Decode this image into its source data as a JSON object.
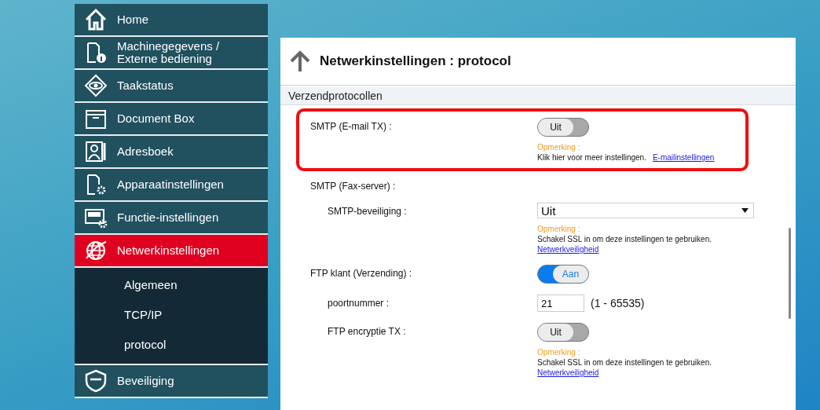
{
  "sidebar": {
    "items": [
      {
        "label": "Home",
        "selected": false
      },
      {
        "label": "Machinegegevens /\nExterne bediening",
        "selected": false
      },
      {
        "label": "Taakstatus",
        "selected": false
      },
      {
        "label": "Document Box",
        "selected": false
      },
      {
        "label": "Adresboek",
        "selected": false
      },
      {
        "label": "Apparaatinstellingen",
        "selected": false
      },
      {
        "label": "Functie-instellingen",
        "selected": false
      },
      {
        "label": "Netwerkinstellingen",
        "selected": true,
        "children": [
          {
            "label": "Algemeen"
          },
          {
            "label": "TCP/IP"
          },
          {
            "label": "protocol"
          }
        ]
      },
      {
        "label": "Beveiliging",
        "selected": false
      }
    ]
  },
  "page": {
    "title": "Netwerkinstellingen : protocol",
    "section": "Verzendprotocollen",
    "settings": [
      {
        "kind": "toggle",
        "label": "SMTP (E-mail TX) :",
        "nested": false,
        "highlighted": true,
        "on": false,
        "value": "Uit",
        "note": {
          "title": "Opmerking :",
          "text": "Klik hier voor meer instellingen.",
          "link": "E-mailinstellingen",
          "inline": true
        }
      },
      {
        "kind": "heading",
        "label": "SMTP (Fax-server) :",
        "nested": false,
        "highlighted": false
      },
      {
        "kind": "select",
        "label": "SMTP-beveiliging :",
        "nested": true,
        "highlighted": false,
        "value": "Uit",
        "note": {
          "title": "Opmerking :",
          "text": "Schakel SSL in om deze instellingen te gebruiken.",
          "link": "Netwerkveiligheid",
          "inline": false
        }
      },
      {
        "kind": "toggle",
        "label": "FTP klant (Verzending) :",
        "nested": false,
        "highlighted": false,
        "on": true,
        "value": "Aan"
      },
      {
        "kind": "number",
        "label": "poortnummer :",
        "nested": true,
        "highlighted": false,
        "value": "21",
        "range": "(1 - 65535)"
      },
      {
        "kind": "toggle",
        "label": "FTP encryptie TX :",
        "nested": true,
        "highlighted": false,
        "on": false,
        "value": "Uit",
        "note": {
          "title": "Opmerking :",
          "text": "Schakel SSL in om deze instellingen te gebruiken.",
          "link": "Netwerkveiligheid",
          "inline": false
        }
      }
    ]
  }
}
